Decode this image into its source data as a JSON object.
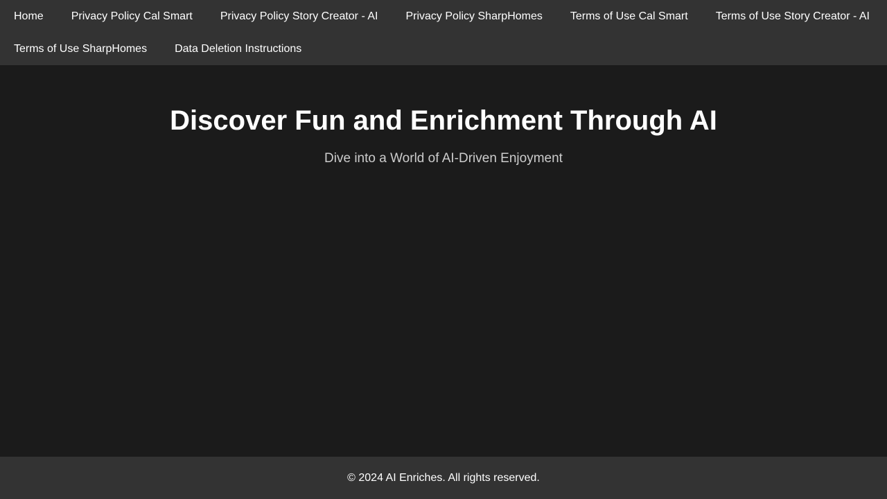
{
  "nav": {
    "items": [
      {
        "label": "Home"
      },
      {
        "label": "Privacy Policy Cal Smart"
      },
      {
        "label": "Privacy Policy Story Creator - AI"
      },
      {
        "label": "Privacy Policy SharpHomes"
      },
      {
        "label": "Terms of Use Cal Smart"
      },
      {
        "label": "Terms of Use Story Creator - AI"
      },
      {
        "label": "Terms of Use SharpHomes"
      },
      {
        "label": "Data Deletion Instructions"
      }
    ]
  },
  "hero": {
    "title": "Discover Fun and Enrichment Through AI",
    "subtitle": "Dive into a World of AI-Driven Enjoyment"
  },
  "footer": {
    "text": "© 2024 AI Enriches. All rights reserved."
  },
  "colors": {
    "background": "#1b1b1b",
    "bar": "#333333",
    "text": "#ffffff",
    "subtext": "#cccccc"
  }
}
